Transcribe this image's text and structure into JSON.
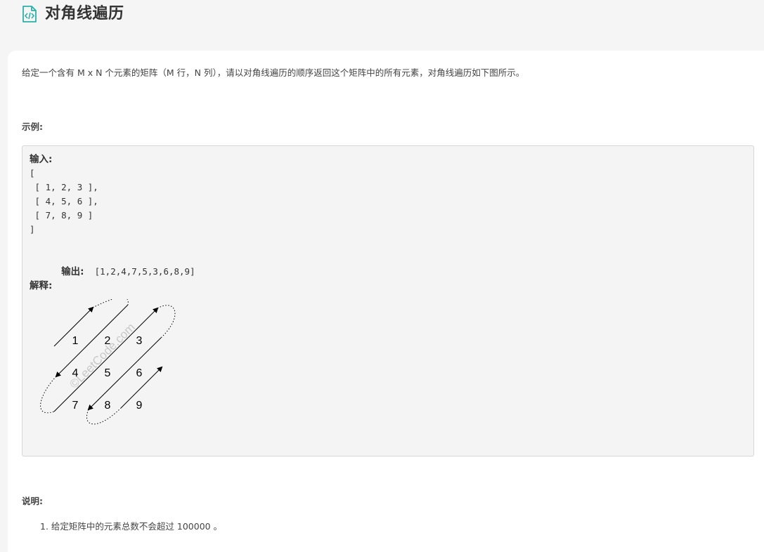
{
  "problem": {
    "title": "对角线遍历",
    "description": "给定一个含有 M x N 个元素的矩阵（M 行，N 列），请以对角线遍历的顺序返回这个矩阵中的所有元素，对角线遍历如下图所示。",
    "example_label": "示例:",
    "note_label": "说明:"
  },
  "example": {
    "input_label": "输入:",
    "input_lines": [
      "[",
      " [ 1, 2, 3 ],",
      " [ 4, 5, 6 ],",
      " [ 7, 8, 9 ]",
      "]"
    ],
    "output_label": "输出:",
    "output_value": "[1,2,4,7,5,3,6,8,9]",
    "explain_label": "解释:"
  },
  "diagram": {
    "watermark": "©LeetCode.com",
    "matrix": [
      [
        "1",
        "2",
        "3"
      ],
      [
        "4",
        "5",
        "6"
      ],
      [
        "7",
        "8",
        "9"
      ]
    ]
  },
  "notes": [
    {
      "number": "1.",
      "text": "给定矩阵中的元素总数不会超过 100000 。"
    }
  ],
  "colors": {
    "accent": "#2db0a6",
    "code_bg": "#f4f4f4",
    "page_bg": "#f5f5f5"
  },
  "icons": {
    "title_icon": "code-file-icon"
  }
}
